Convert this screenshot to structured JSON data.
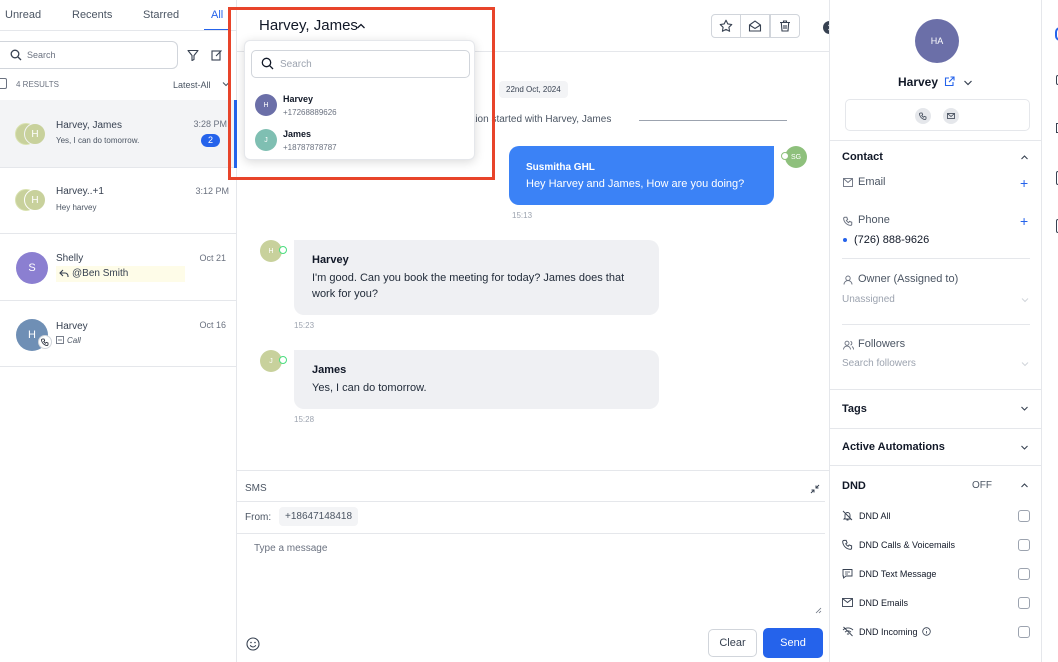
{
  "left": {
    "tabs": [
      "Unread",
      "Recents",
      "Starred",
      "All"
    ],
    "search_placeholder": "Search",
    "results_count": "4 RESULTS",
    "sort_label": "Latest-All",
    "conversations": [
      {
        "name": "Harvey, James",
        "preview": "Yes, I can do tomorrow.",
        "time": "3:28 PM",
        "badge": "2",
        "avatar": "H"
      },
      {
        "name": "Harvey..+1",
        "preview": "Hey harvey",
        "time": "3:12 PM",
        "avatar": "H"
      },
      {
        "name": "Shelly",
        "preview": "@Ben Smith",
        "time": "Oct 21",
        "avatar": "S"
      },
      {
        "name": "Harvey",
        "preview": "Call",
        "time": "Oct 16",
        "avatar": "H"
      }
    ]
  },
  "header": {
    "title": "Harvey, James"
  },
  "dropdown": {
    "search_placeholder": "Search",
    "contacts": [
      {
        "initial": "H",
        "name": "Harvey",
        "phone": "+17268889626"
      },
      {
        "initial": "J",
        "name": "James",
        "phone": "+18787878787"
      }
    ]
  },
  "thread": {
    "date": "22nd Oct, 2024",
    "system_text": "ation started with Harvey, James",
    "messages": [
      {
        "sender": "Susmitha GHL",
        "text": "Hey Harvey and James, How are you doing?",
        "time": "15:13",
        "avatar": "SG"
      },
      {
        "sender": "Harvey",
        "text1": "I'm good. Can you book the meeting for today? James does that",
        "text2": "work for you?",
        "time": "15:23",
        "avatar": "H"
      },
      {
        "sender": "James",
        "text": "Yes, I can do tomorrow.",
        "time": "15:28",
        "avatar": "J"
      }
    ]
  },
  "composer": {
    "channel": "SMS",
    "from_label": "From:",
    "from_number": "+18647148418",
    "placeholder": "Type a message",
    "clear_label": "Clear",
    "send_label": "Send"
  },
  "contact_panel": {
    "avatar": "HA",
    "name": "Harvey",
    "contact_title": "Contact",
    "email_label": "Email",
    "phone_label": "Phone",
    "phone_value": "(726) 888-9626",
    "owner_label": "Owner (Assigned to)",
    "owner_value": "Unassigned",
    "followers_label": "Followers",
    "followers_placeholder": "Search followers",
    "tags_title": "Tags",
    "automations_title": "Active Automations",
    "dnd_title": "DND",
    "dnd_status": "OFF",
    "dnd_items": [
      "DND All",
      "DND Calls & Voicemails",
      "DND Text Message",
      "DND Emails",
      "DND Incoming"
    ]
  },
  "colors": {
    "accent": "#2563eb",
    "outgoing_bubble": "#3b82f6",
    "highlight": "#e8442a",
    "incoming_bubble": "#eff0f3"
  }
}
